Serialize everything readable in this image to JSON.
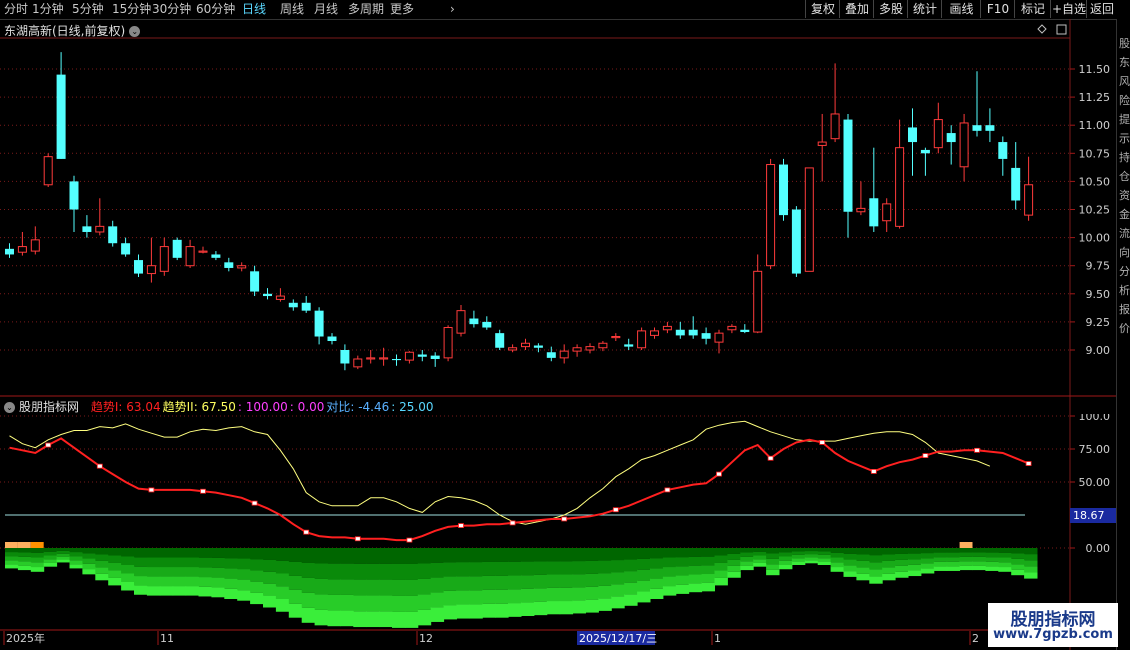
{
  "toolbar": {
    "periods": [
      "分时",
      "1分钟",
      "5分钟",
      "15分钟",
      "30分钟",
      "60分钟",
      "日线",
      "周线",
      "月线",
      "多周期",
      "更多"
    ],
    "active_period": "日线",
    "right_buttons": [
      "复权",
      "叠加",
      "多股",
      "统计",
      "画线",
      "F10",
      "标记",
      "+自选",
      "返回"
    ]
  },
  "main_chart": {
    "title": "东湖高新(日线,前复权)",
    "price_ticks": [
      "11.50",
      "11.25",
      "11.00",
      "10.75",
      "10.50",
      "10.25",
      "10.00",
      "9.75",
      "9.50",
      "9.25",
      "9.00"
    ]
  },
  "indicator": {
    "name": "股朋指标网",
    "legend": [
      {
        "text": "趋势I: 63.04",
        "color": "#ff2020"
      },
      {
        "text": "趋势II: 67.50",
        "color": "#ffff60"
      },
      {
        "text": ": 100.00",
        "color": "#ff40ff"
      },
      {
        "text": ": 0.00",
        "color": "#ff40ff"
      },
      {
        "text": "对比: -4.46",
        "color": "#5ab0ff"
      },
      {
        "text": ": 25.00",
        "color": "#5ad8ff"
      }
    ],
    "ticks": [
      "100.0",
      "75.00",
      "50.00",
      "0.00"
    ],
    "hline_value": "18.67"
  },
  "time_axis": {
    "labels": [
      "2025年",
      "11",
      "12",
      "1",
      "2"
    ],
    "cursor_date": "2025/12/17/三"
  },
  "side_panel_chars": [
    "股",
    "东",
    "风",
    "险",
    "提",
    "示",
    "持",
    "仓",
    "资",
    "金",
    "流",
    "向",
    "分",
    "析",
    "报",
    "价"
  ],
  "watermark": {
    "line1": "股朋指标网",
    "line2": "www.7gpzb.com"
  },
  "colors": {
    "up": "#ff3b3b",
    "down": "#54ffff",
    "trend1": "#ff2020",
    "trend2": "#ffff80",
    "grid": "#7a1a1a"
  },
  "chart_data": {
    "type": "candlestick",
    "title": "东湖高新(日线,前复权)",
    "ylim": [
      8.8,
      11.7
    ],
    "candles": [
      {
        "o": 9.9,
        "c": 9.85,
        "h": 9.95,
        "l": 9.82
      },
      {
        "o": 9.87,
        "c": 9.92,
        "h": 10.05,
        "l": 9.84
      },
      {
        "o": 9.88,
        "c": 9.98,
        "h": 10.1,
        "l": 9.85
      },
      {
        "o": 10.47,
        "c": 10.72,
        "h": 10.75,
        "l": 10.45
      },
      {
        "o": 11.45,
        "c": 10.7,
        "h": 11.65,
        "l": 10.7
      },
      {
        "o": 10.5,
        "c": 10.25,
        "h": 10.55,
        "l": 10.05
      },
      {
        "o": 10.1,
        "c": 10.05,
        "h": 10.2,
        "l": 10.0
      },
      {
        "o": 10.05,
        "c": 10.1,
        "h": 10.35,
        "l": 10.02
      },
      {
        "o": 10.1,
        "c": 9.95,
        "h": 10.15,
        "l": 9.92
      },
      {
        "o": 9.95,
        "c": 9.85,
        "h": 10.0,
        "l": 9.83
      },
      {
        "o": 9.8,
        "c": 9.68,
        "h": 9.85,
        "l": 9.65
      },
      {
        "o": 9.68,
        "c": 9.75,
        "h": 10.0,
        "l": 9.6
      },
      {
        "o": 9.7,
        "c": 9.92,
        "h": 10.0,
        "l": 9.66
      },
      {
        "o": 9.98,
        "c": 9.82,
        "h": 10.0,
        "l": 9.8
      },
      {
        "o": 9.75,
        "c": 9.92,
        "h": 9.98,
        "l": 9.73
      },
      {
        "o": 9.87,
        "c": 9.88,
        "h": 9.92,
        "l": 9.86
      },
      {
        "o": 9.85,
        "c": 9.82,
        "h": 9.88,
        "l": 9.8
      },
      {
        "o": 9.78,
        "c": 9.73,
        "h": 9.82,
        "l": 9.7
      },
      {
        "o": 9.73,
        "c": 9.75,
        "h": 9.78,
        "l": 9.7
      },
      {
        "o": 9.7,
        "c": 9.52,
        "h": 9.75,
        "l": 9.48
      },
      {
        "o": 9.5,
        "c": 9.48,
        "h": 9.55,
        "l": 9.45
      },
      {
        "o": 9.45,
        "c": 9.48,
        "h": 9.55,
        "l": 9.43
      },
      {
        "o": 9.42,
        "c": 9.38,
        "h": 9.45,
        "l": 9.35
      },
      {
        "o": 9.42,
        "c": 9.35,
        "h": 9.48,
        "l": 9.33
      },
      {
        "o": 9.35,
        "c": 9.12,
        "h": 9.38,
        "l": 9.05
      },
      {
        "o": 9.12,
        "c": 9.08,
        "h": 9.15,
        "l": 9.05
      },
      {
        "o": 9.0,
        "c": 8.88,
        "h": 9.05,
        "l": 8.82
      },
      {
        "o": 8.85,
        "c": 8.92,
        "h": 8.95,
        "l": 8.83
      },
      {
        "o": 8.92,
        "c": 8.93,
        "h": 9.0,
        "l": 8.88
      },
      {
        "o": 8.92,
        "c": 8.93,
        "h": 9.02,
        "l": 8.86
      },
      {
        "o": 8.92,
        "c": 8.91,
        "h": 8.96,
        "l": 8.86
      },
      {
        "o": 8.91,
        "c": 8.98,
        "h": 8.99,
        "l": 8.88
      },
      {
        "o": 8.96,
        "c": 8.94,
        "h": 9.0,
        "l": 8.9
      },
      {
        "o": 8.95,
        "c": 8.92,
        "h": 8.98,
        "l": 8.85
      },
      {
        "o": 8.93,
        "c": 9.2,
        "h": 9.22,
        "l": 8.9
      },
      {
        "o": 9.15,
        "c": 9.35,
        "h": 9.4,
        "l": 9.12
      },
      {
        "o": 9.28,
        "c": 9.23,
        "h": 9.35,
        "l": 9.2
      },
      {
        "o": 9.25,
        "c": 9.2,
        "h": 9.3,
        "l": 9.18
      },
      {
        "o": 9.15,
        "c": 9.02,
        "h": 9.18,
        "l": 9.0
      },
      {
        "o": 9.0,
        "c": 9.02,
        "h": 9.05,
        "l": 8.98
      },
      {
        "o": 9.03,
        "c": 9.06,
        "h": 9.1,
        "l": 9.0
      },
      {
        "o": 9.04,
        "c": 9.02,
        "h": 9.06,
        "l": 8.98
      },
      {
        "o": 8.98,
        "c": 8.93,
        "h": 9.03,
        "l": 8.9
      },
      {
        "o": 8.93,
        "c": 8.99,
        "h": 9.05,
        "l": 8.88
      },
      {
        "o": 8.99,
        "c": 9.02,
        "h": 9.05,
        "l": 8.94
      },
      {
        "o": 9.0,
        "c": 9.03,
        "h": 9.06,
        "l": 8.97
      },
      {
        "o": 9.02,
        "c": 9.06,
        "h": 9.08,
        "l": 8.99
      },
      {
        "o": 9.11,
        "c": 9.12,
        "h": 9.15,
        "l": 9.08
      },
      {
        "o": 9.05,
        "c": 9.03,
        "h": 9.1,
        "l": 9.0
      },
      {
        "o": 9.02,
        "c": 9.17,
        "h": 9.2,
        "l": 9.0
      },
      {
        "o": 9.13,
        "c": 9.17,
        "h": 9.2,
        "l": 9.1
      },
      {
        "o": 9.18,
        "c": 9.21,
        "h": 9.25,
        "l": 9.15
      },
      {
        "o": 9.18,
        "c": 9.13,
        "h": 9.25,
        "l": 9.1
      },
      {
        "o": 9.18,
        "c": 9.13,
        "h": 9.3,
        "l": 9.1
      },
      {
        "o": 9.15,
        "c": 9.1,
        "h": 9.2,
        "l": 9.05
      },
      {
        "o": 9.07,
        "c": 9.15,
        "h": 9.18,
        "l": 8.97
      },
      {
        "o": 9.18,
        "c": 9.21,
        "h": 9.23,
        "l": 9.15
      },
      {
        "o": 9.18,
        "c": 9.16,
        "h": 9.23,
        "l": 9.15
      },
      {
        "o": 9.16,
        "c": 9.7,
        "h": 9.85,
        "l": 9.15
      },
      {
        "o": 9.75,
        "c": 10.65,
        "h": 10.7,
        "l": 9.72
      },
      {
        "o": 10.65,
        "c": 10.2,
        "h": 10.7,
        "l": 10.15
      },
      {
        "o": 10.25,
        "c": 9.68,
        "h": 10.28,
        "l": 9.65
      },
      {
        "o": 9.7,
        "c": 10.62,
        "h": 10.62,
        "l": 9.7
      },
      {
        "o": 10.82,
        "c": 10.85,
        "h": 11.1,
        "l": 10.5
      },
      {
        "o": 10.88,
        "c": 11.1,
        "h": 11.55,
        "l": 10.85
      },
      {
        "o": 11.05,
        "c": 10.23,
        "h": 11.1,
        "l": 10.0
      },
      {
        "o": 10.23,
        "c": 10.26,
        "h": 10.5,
        "l": 10.2
      },
      {
        "o": 10.35,
        "c": 10.1,
        "h": 10.8,
        "l": 10.05
      },
      {
        "o": 10.15,
        "c": 10.3,
        "h": 10.35,
        "l": 10.05
      },
      {
        "o": 10.1,
        "c": 10.8,
        "h": 11.05,
        "l": 10.08
      },
      {
        "o": 10.98,
        "c": 10.85,
        "h": 11.15,
        "l": 10.55
      },
      {
        "o": 10.78,
        "c": 10.75,
        "h": 10.8,
        "l": 10.55
      },
      {
        "o": 10.8,
        "c": 11.05,
        "h": 11.2,
        "l": 10.75
      },
      {
        "o": 10.93,
        "c": 10.85,
        "h": 11.0,
        "l": 10.65
      },
      {
        "o": 10.63,
        "c": 11.02,
        "h": 11.1,
        "l": 10.5
      },
      {
        "o": 11.0,
        "c": 10.95,
        "h": 11.48,
        "l": 10.9
      },
      {
        "o": 11.0,
        "c": 10.95,
        "h": 11.15,
        "l": 10.85
      },
      {
        "o": 10.85,
        "c": 10.7,
        "h": 10.9,
        "l": 10.55
      },
      {
        "o": 10.62,
        "c": 10.33,
        "h": 10.85,
        "l": 10.25
      },
      {
        "o": 10.2,
        "c": 10.47,
        "h": 10.72,
        "l": 10.15
      }
    ],
    "indicator": {
      "series": [
        {
          "name": "趋势I",
          "values": [
            76,
            74,
            72,
            78,
            83,
            76,
            69,
            62,
            56,
            50,
            45,
            44,
            44,
            44,
            44,
            43,
            42,
            40,
            38,
            34,
            30,
            25,
            18,
            12,
            9,
            8,
            8,
            7,
            7,
            7,
            6,
            6,
            9,
            13,
            16,
            17,
            17,
            18,
            18,
            19,
            20,
            21,
            22,
            22,
            23,
            24,
            26,
            29,
            32,
            36,
            40,
            44,
            46,
            48,
            49,
            56,
            65,
            74,
            78,
            68,
            75,
            80,
            82,
            80,
            72,
            66,
            62,
            58,
            62,
            65,
            67,
            70,
            73,
            73,
            74,
            74,
            73,
            72,
            68,
            64
          ]
        },
        {
          "name": "趋势II",
          "values": [
            85,
            79,
            76,
            82,
            86,
            89,
            89,
            92,
            91,
            94,
            90,
            87,
            84,
            84,
            88,
            90,
            89,
            91,
            92,
            88,
            86,
            74,
            60,
            42,
            35,
            32,
            32,
            32,
            38,
            38,
            35,
            30,
            27,
            35,
            39,
            38,
            36,
            32,
            25,
            20,
            18,
            20,
            22,
            25,
            30,
            38,
            45,
            54,
            60,
            67,
            70,
            74,
            78,
            82,
            90,
            93,
            95,
            96,
            92,
            88,
            85,
            82,
            81,
            81,
            81,
            83,
            85,
            87,
            88,
            88,
            86,
            80,
            72,
            70,
            68,
            66,
            62
          ]
        }
      ]
    }
  }
}
